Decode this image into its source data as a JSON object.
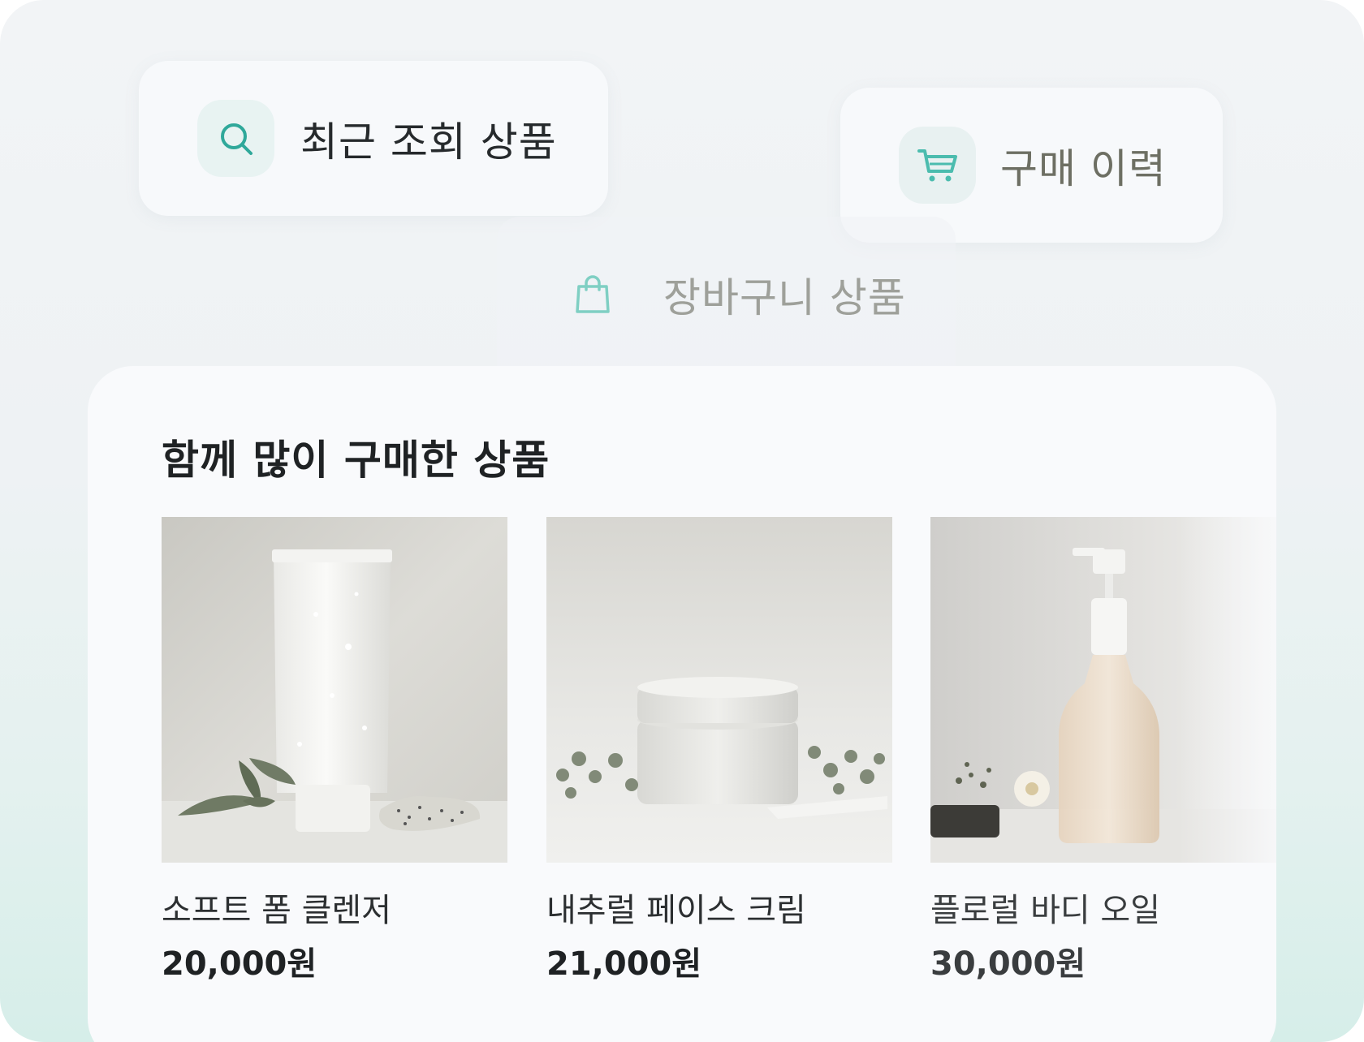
{
  "chips": {
    "recent": {
      "label": "최근 조회 상품",
      "icon": "search-icon"
    },
    "purchase": {
      "label": "구매 이력",
      "icon": "cart-icon"
    },
    "cart": {
      "label": "장바구니 상품",
      "icon": "shopping-bag-icon"
    }
  },
  "section": {
    "title": "함께 많이 구매한 상품"
  },
  "products": [
    {
      "name": "소프트 폼 클렌저",
      "price": "20,000원",
      "image": "cleanser-tube-image"
    },
    {
      "name": "내추럴 페이스 크림",
      "price": "21,000원",
      "image": "face-cream-jar-image"
    },
    {
      "name": "플로럴 바디 오일",
      "price": "30,000원",
      "image": "body-oil-bottle-image"
    }
  ],
  "colors": {
    "accent": "#2fa89a",
    "panel": "#f9fafc",
    "text_primary": "#1f2224"
  }
}
